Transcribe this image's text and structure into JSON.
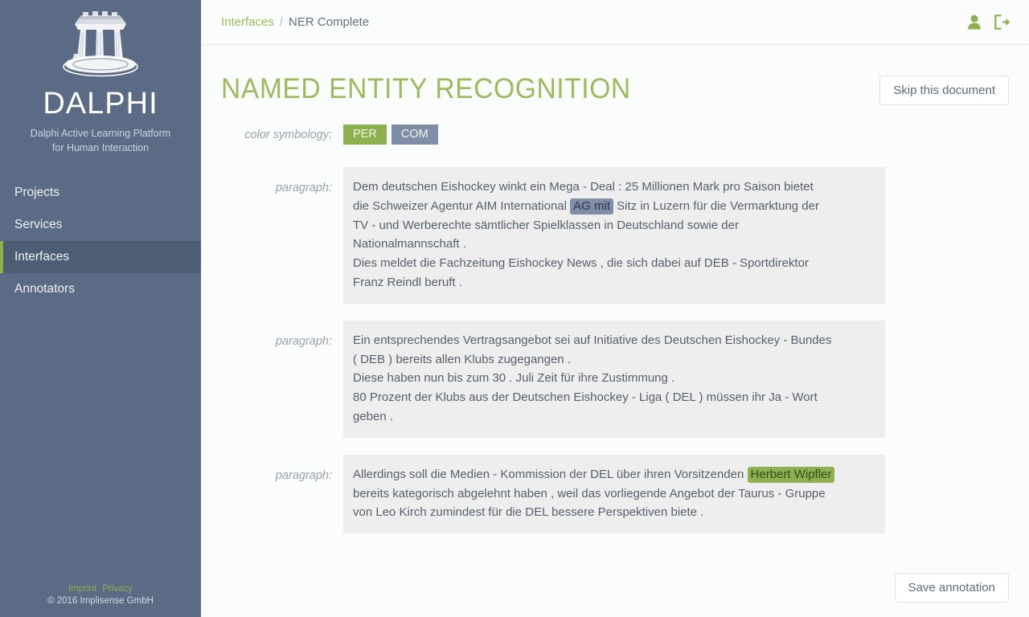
{
  "sidebar": {
    "brand_name": "DALPHI",
    "logo_icon": "temple-ruins-logo",
    "tagline_line1": "Dalphi Active Learning Platform",
    "tagline_line2": "for Human Interaction",
    "nav": [
      {
        "label": "Projects",
        "active": false
      },
      {
        "label": "Services",
        "active": false
      },
      {
        "label": "Interfaces",
        "active": true
      },
      {
        "label": "Annotators",
        "active": false
      }
    ],
    "footer": {
      "imprint": "Imprint",
      "privacy": "Privacy",
      "copyright": "© 2016 Implisense GmbH"
    },
    "colors": {
      "background": "#5b6b86",
      "active_background": "#4e5d76",
      "active_accent": "#8cb14e",
      "link": "#8cb14e"
    }
  },
  "topbar": {
    "breadcrumb": {
      "parent": "Interfaces",
      "separator": "/",
      "current": "NER Complete"
    },
    "icons": [
      {
        "name": "user-icon",
        "color": "#8cb14e"
      },
      {
        "name": "sign-out-icon",
        "color": "#8cb14e"
      }
    ]
  },
  "main": {
    "page_title": "NAMED ENTITY RECOGNITION",
    "page_title_color": "#9cbb5c",
    "skip_button": "Skip this document",
    "save_button": "Save annotation",
    "symbology_label": "color symbology:",
    "legend": [
      {
        "code": "PER",
        "color": "#8cb14e"
      },
      {
        "code": "COM",
        "color": "#7f8da6"
      }
    ],
    "paragraph_label": "paragraph:",
    "paragraphs": [
      {
        "lines": [
          "Dem deutschen Eishockey winkt ein Mega - Deal : 25 Millionen Mark pro Saison bietet",
          "die Schweizer Agentur AIM International |ENT:COM:AG mit| Sitz in Luzern für die Vermarktung der",
          "TV - und Werberechte sämtlicher Spielklassen in Deutschland sowie der",
          "Nationalmannschaft .",
          "Dies meldet die Fachzeitung Eishockey News , die sich dabei auf DEB - Sportdirektor",
          "Franz Reindl beruft ."
        ]
      },
      {
        "lines": [
          "Ein entsprechendes Vertragsangebot sei auf Initiative des Deutschen Eishockey - Bundes",
          "( DEB ) bereits allen Klubs zugegangen .",
          "Diese haben nun bis zum 30 . Juli Zeit für ihre Zustimmung .",
          "80 Prozent der Klubs aus der Deutschen Eishockey - Liga ( DEL ) müssen ihr Ja - Wort",
          "geben ."
        ]
      },
      {
        "lines": [
          "Allerdings soll die Medien - Kommission der DEL über ihren Vorsitzenden |ENT:PER:Herbert Wipfler|",
          "bereits kategorisch abgelehnt haben , weil das vorliegende Angebot der Taurus - Gruppe",
          "von Leo Kirch zumindest für die DEL bessere Perspektiven biete ."
        ]
      }
    ]
  }
}
